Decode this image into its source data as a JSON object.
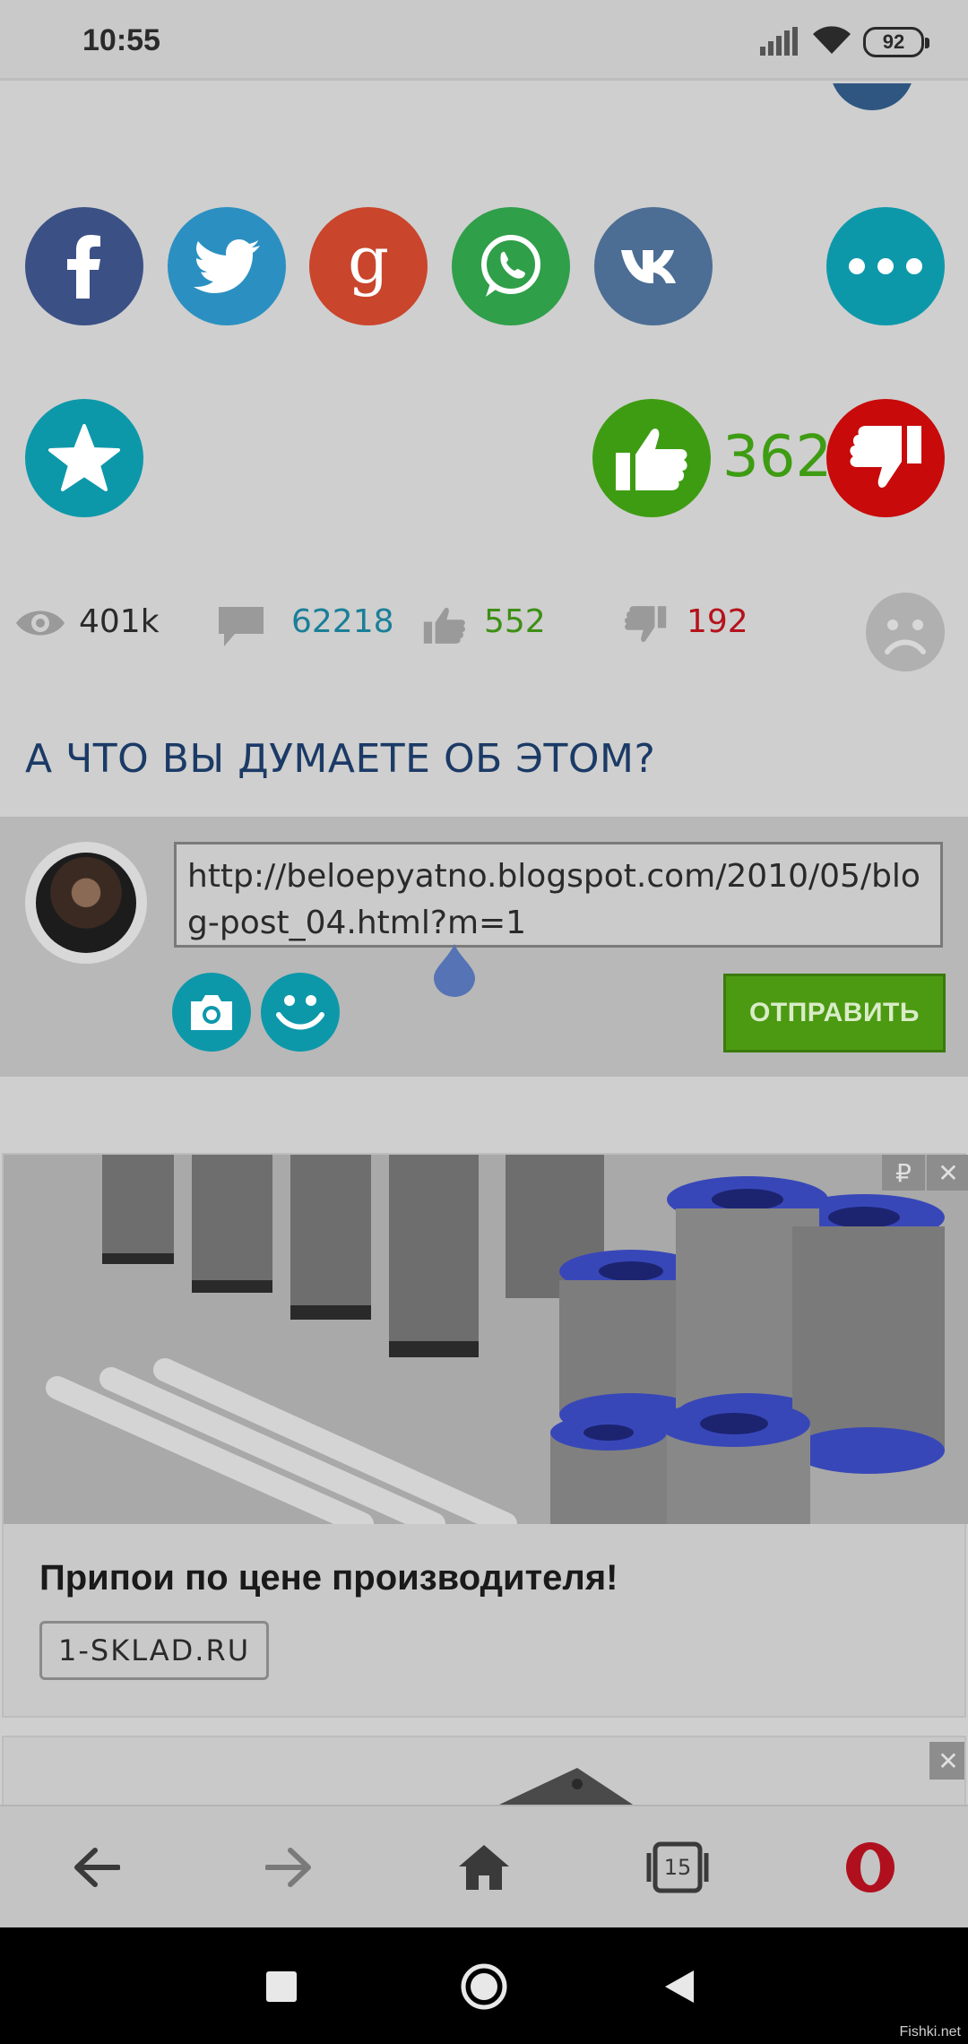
{
  "status_bar": {
    "time": "10:55",
    "battery": "92"
  },
  "reactions": {
    "like_count": "362"
  },
  "stats": {
    "views": "401k",
    "comments": "62218",
    "likes": "552",
    "dislikes": "192"
  },
  "comment_section": {
    "heading": "А ЧТО ВЫ ДУМАЕТЕ ОБ ЭТОМ?",
    "input_value": "http://beloepyatno.blogspot.com/2010/05/blog-post_04.html?m=1",
    "send_label": "ОТПРАВИТЬ"
  },
  "ad": {
    "title": "Припои по цене производителя!",
    "domain": "1-SKLAD.RU",
    "price_badge": "₽",
    "close_label": "✕"
  },
  "ad2": {
    "close_label": "✕"
  },
  "browser_nav": {
    "tabs_count": "15"
  },
  "watermark": "Fishki.net",
  "colors": {
    "facebook": "#3b5186",
    "twitter": "#2b90c1",
    "google": "#c9452c",
    "whatsapp": "#2f9f49",
    "vk": "#4c6d94",
    "accent": "#0d98aa",
    "like": "#3e9c13",
    "dislike": "#c80a0a",
    "send": "#4c9a12"
  }
}
